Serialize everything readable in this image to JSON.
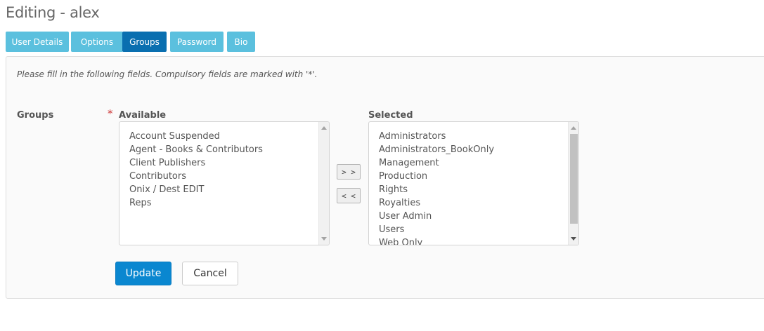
{
  "page": {
    "title": "Editing - alex"
  },
  "tabs": [
    {
      "label": "User Details",
      "active": false
    },
    {
      "label": "Options",
      "active": false
    },
    {
      "label": "Groups",
      "active": true
    },
    {
      "label": "Password",
      "active": false
    },
    {
      "label": "Bio",
      "active": false
    }
  ],
  "form": {
    "instructions": "Please fill in the following fields. Compulsory fields are marked with '*'.",
    "groups_label": "Groups",
    "required_marker": "*",
    "available_heading": "Available",
    "selected_heading": "Selected",
    "available": [
      "Account Suspended",
      "Agent - Books & Contributors",
      "Client Publishers",
      "Contributors",
      "Onix / Dest EDIT",
      "Reps"
    ],
    "selected": [
      "Administrators",
      "Administrators_BookOnly",
      "Management",
      "Production",
      "Rights",
      "Royalties",
      "User Admin",
      "Users",
      "Web Only"
    ],
    "add_button": "> >",
    "remove_button": "< <",
    "update_button": "Update",
    "cancel_button": "Cancel"
  },
  "colors": {
    "tab": "#5bc0de",
    "tab_active": "#0a6fb0",
    "primary": "#0a87d0",
    "required": "#cc3333"
  }
}
